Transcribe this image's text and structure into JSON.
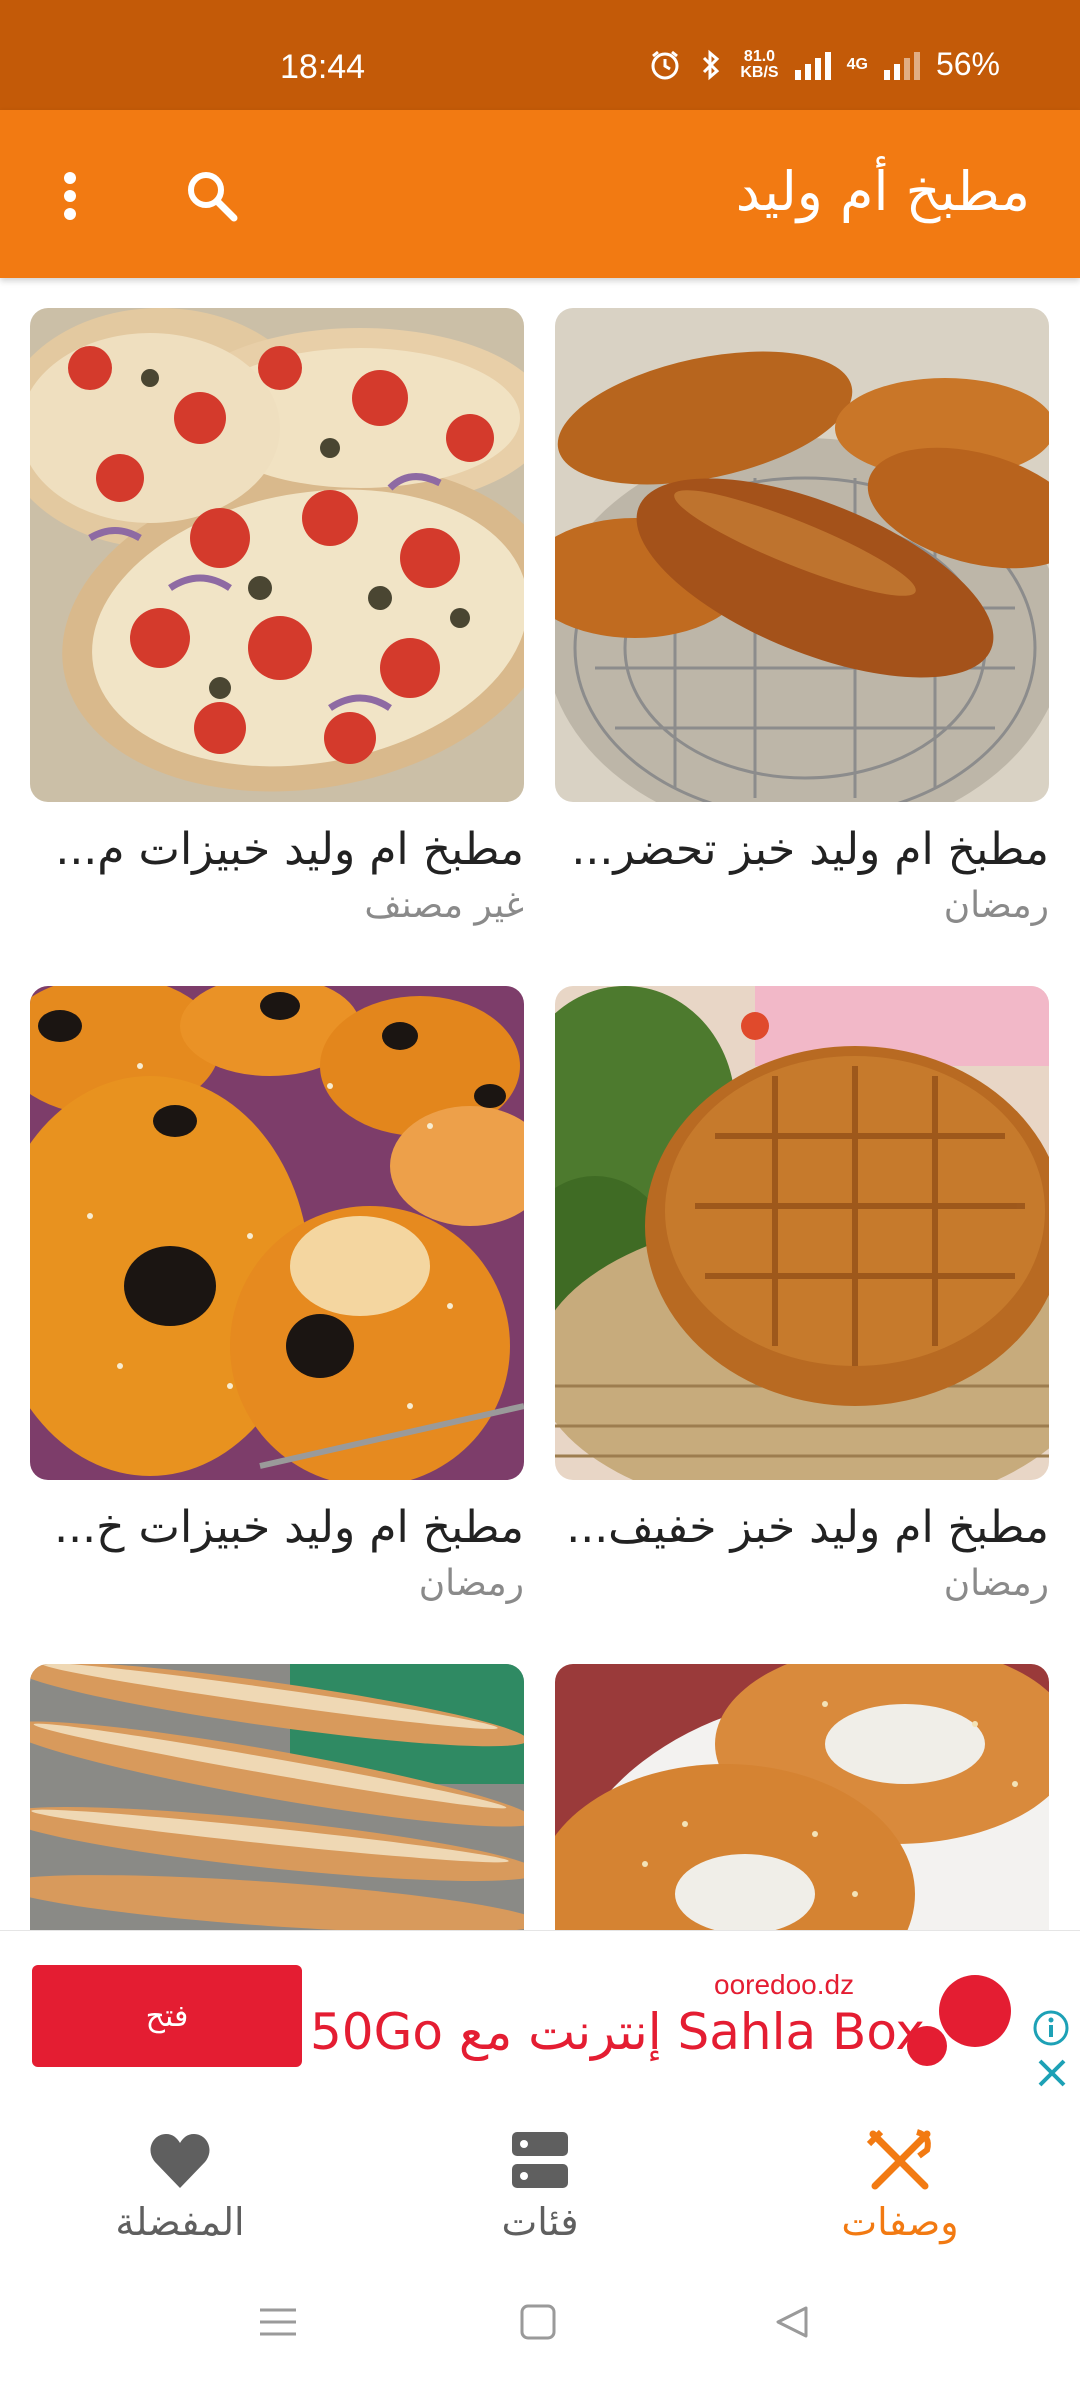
{
  "status_bar": {
    "time": "18:44",
    "net_speed_value": "81.0",
    "net_speed_unit": "KB/S",
    "network": "4G",
    "battery": "56%",
    "icons": [
      "alarm-icon",
      "bluetooth-icon",
      "signal-icon",
      "battery-icon"
    ]
  },
  "app_bar": {
    "title": "مطبخ أم وليد",
    "icons": [
      "search-icon",
      "more-vert-icon"
    ]
  },
  "recipes": [
    {
      "title": "مطبخ ام وليد خبز تحضر...",
      "category": "رمضان",
      "image": "bread-rolls-photo"
    },
    {
      "title": "مطبخ ام وليد خبيزات م...",
      "category": "غير مصنف",
      "image": "pizza-bread-photo"
    },
    {
      "title": "مطبخ ام وليد خبز خفيف...",
      "category": "رمضان",
      "image": "round-bread-photo"
    },
    {
      "title": "مطبخ ام وليد خبيزات خ...",
      "category": "رمضان",
      "image": "olive-buns-photo"
    },
    {
      "title": "",
      "category": "",
      "image": "sesame-ring-bread-photo"
    },
    {
      "title": "",
      "category": "",
      "image": "breadsticks-photo"
    }
  ],
  "ad": {
    "domain": "ooredoo.dz",
    "headline": "Sahla Box إنترنت مع 50Go",
    "cta": "فتح",
    "brand_color": "#e41d32"
  },
  "bottom_nav": {
    "items": [
      {
        "label": "وصفات",
        "icon": "fork-knife-icon",
        "active": true
      },
      {
        "label": "فئات",
        "icon": "categories-icon",
        "active": false
      },
      {
        "label": "المفضلة",
        "icon": "heart-icon",
        "active": false
      }
    ],
    "active_color": "#f27a12",
    "inactive_color": "#5f5f5f"
  },
  "colors": {
    "status_bar": "#c35a08",
    "app_bar": "#f27a12"
  }
}
